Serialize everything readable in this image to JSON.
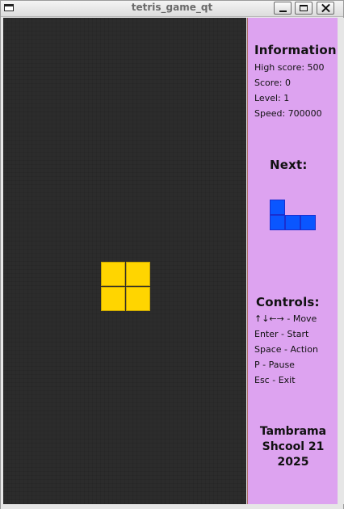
{
  "window": {
    "title": "tetris_game_qt"
  },
  "game": {
    "current_piece": {
      "type": "O",
      "color": "#ffd500"
    },
    "next_piece": {
      "type": "J",
      "color": "#0a56ff"
    },
    "board_color": "#2c2c2c"
  },
  "panel": {
    "background": "#dda3f0",
    "info_heading": "Information:",
    "high_score": "High score: 500",
    "score": "Score: 0",
    "level": "Level: 1",
    "speed": "Speed: 700000",
    "next_heading": "Next:",
    "controls_heading": "Controls:",
    "controls": [
      "↑↓←→ - Move",
      "Enter - Start",
      "Space - Action",
      "P - Pause",
      "Esc - Exit"
    ],
    "credit": [
      "Tambrama",
      "Shcool 21",
      "2025"
    ]
  }
}
